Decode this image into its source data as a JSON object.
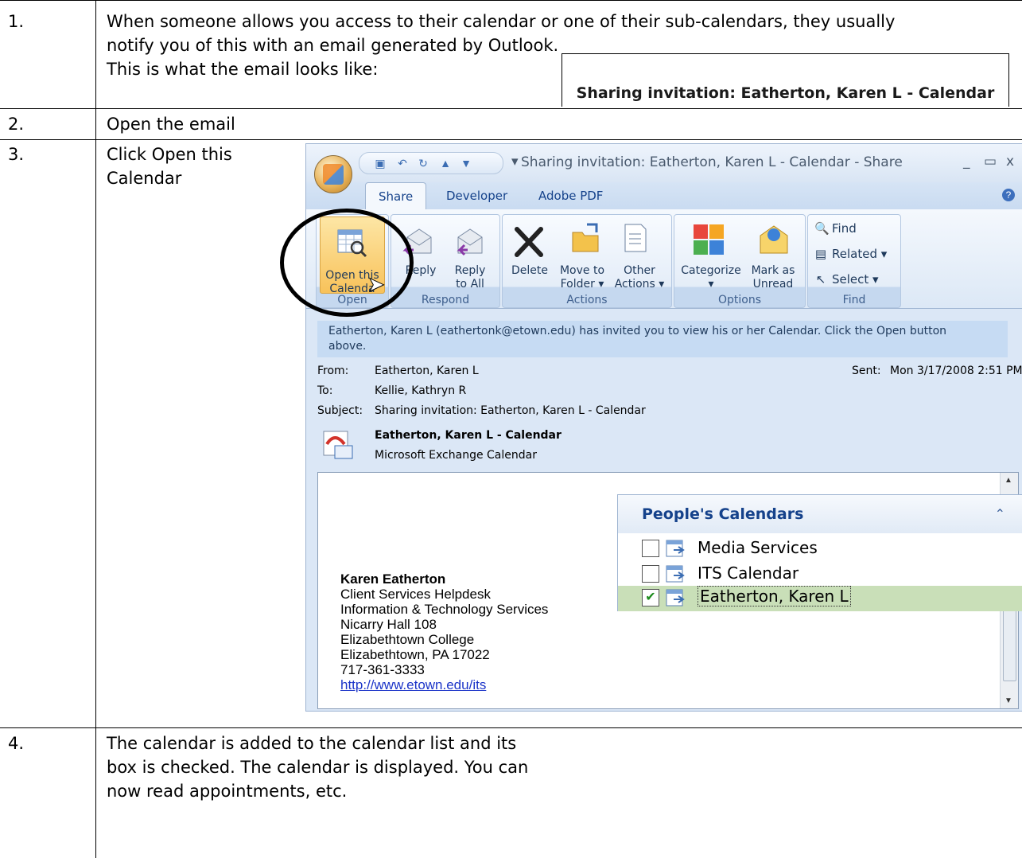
{
  "steps": [
    {
      "num": "1.",
      "lines": [
        "When someone allows you access to their calendar or one of their sub-calendars, they usually",
        "notify you of this with an email generated by Outlook.",
        "This is what the email looks like:"
      ]
    },
    {
      "num": "2.",
      "text": "Open the email"
    },
    {
      "num": "3.",
      "lines": [
        "Click Open this",
        "Calendar"
      ]
    },
    {
      "num": "4.",
      "lines": [
        "The calendar is added to the calendar list and its",
        "box is checked. The calendar is displayed. You can",
        "now read appointments, etc."
      ]
    }
  ],
  "subject_banner": "Sharing invitation: Eatherton, Karen L - Calendar",
  "window": {
    "title": "Sharing invitation: Eatherton, Karen L - Calendar - Share",
    "controls": [
      "_",
      "▭",
      "x"
    ],
    "tabs": [
      "Share",
      "Developer",
      "Adobe PDF"
    ],
    "groups": {
      "open": {
        "label": "Open",
        "button": [
          "Open this",
          "Calenda"
        ]
      },
      "respond": {
        "label": "Respond",
        "reply": "Reply",
        "reply_all": [
          "Reply",
          "to All"
        ]
      },
      "actions": {
        "label": "Actions",
        "delete": "Delete",
        "move": [
          "Move to",
          "Folder ▾"
        ],
        "other": [
          "Other",
          "Actions ▾"
        ]
      },
      "options": {
        "label": "Options",
        "categorize": [
          "Categorize",
          "▾"
        ],
        "mark": [
          "Mark as",
          "Unread"
        ]
      },
      "find": {
        "label": "Find",
        "find": "Find",
        "related": "Related ▾",
        "select": "Select ▾"
      }
    },
    "infobar": [
      "Eatherton, Karen L (eathertonk@etown.edu) has invited you to view his or her Calendar.  Click the Open button",
      "above."
    ],
    "from_label": "From:",
    "from": "Eatherton, Karen L",
    "sent_label": "Sent:",
    "sent": "Mon 3/17/2008 2:51 PM",
    "to_label": "To:",
    "to": "Kellie, Kathryn R",
    "subject_label": "Subject:",
    "subject": "Sharing invitation: Eatherton, Karen L - Calendar",
    "attachment_name": "Eatherton, Karen L - Calendar",
    "attachment_type": "Microsoft Exchange Calendar",
    "signature": {
      "name": "Karen Eatherton",
      "lines": [
        "Client Services Helpdesk",
        "Information & Technology Services",
        "Nicarry Hall 108",
        "Elizabethtown College",
        "Elizabethtown, PA 17022"
      ],
      "phone": "717-361-3333",
      "link": "http://www.etown.edu/its"
    }
  },
  "people_calendars": {
    "title": "People's Calendars",
    "items": [
      {
        "label": "Media Services",
        "checked": false
      },
      {
        "label": "ITS Calendar",
        "checked": false
      },
      {
        "label": "Eatherton, Karen L",
        "checked": true
      }
    ]
  },
  "colors": {
    "ribbon_text": "#15428b",
    "link": "#1b34c8",
    "selected_row": "#c9dfb8"
  }
}
